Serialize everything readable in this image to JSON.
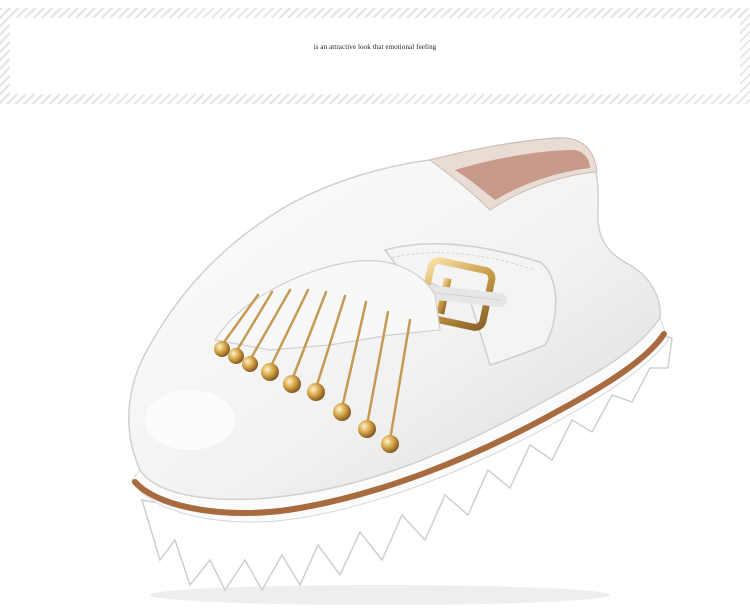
{
  "banner": {
    "caption": "is an attractive look that emotional feeling"
  },
  "product": {
    "icon": "shoe-icon",
    "colors": {
      "upper": "#f6f6f6",
      "sole": "#ffffff",
      "welt": "#a86b3f",
      "hardware": "#d7a650"
    }
  }
}
